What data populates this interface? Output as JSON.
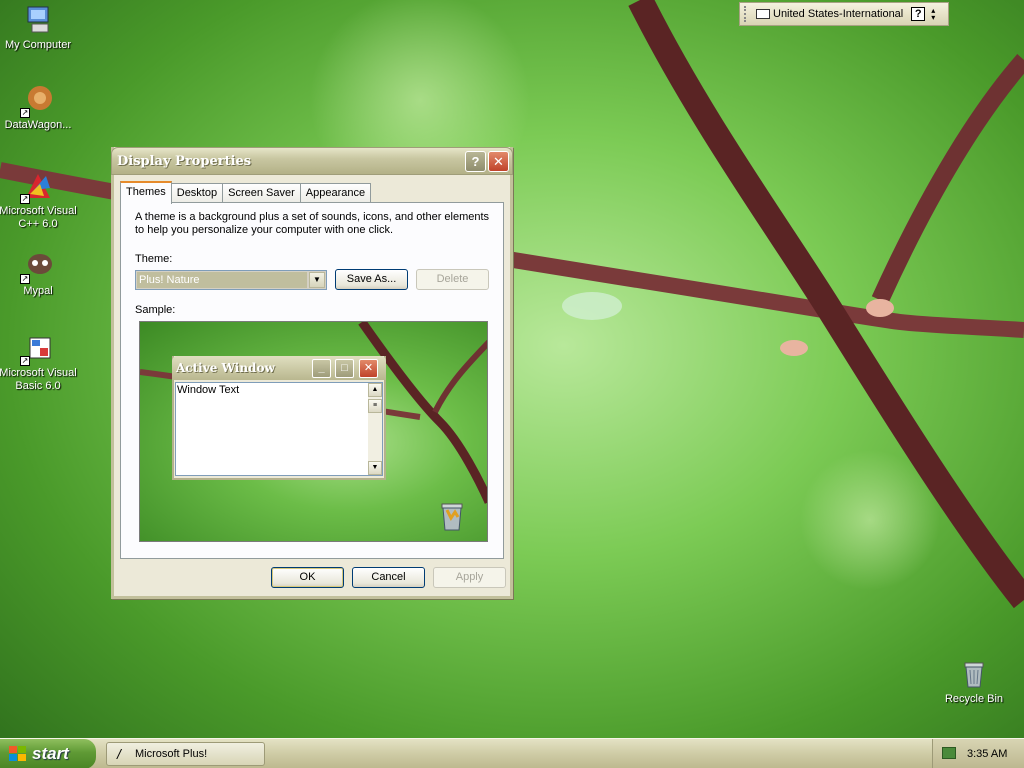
{
  "desktop": {
    "icons": [
      {
        "label": "My Computer"
      },
      {
        "label": "DataWagon..."
      },
      {
        "label": "Microsoft Visual C++ 6.0"
      },
      {
        "label": "Mypal"
      },
      {
        "label": "Microsoft Visual Basic 6.0"
      },
      {
        "label": "Recycle Bin"
      }
    ]
  },
  "langbar": {
    "language": "United States-International",
    "help_glyph": "?"
  },
  "dialog": {
    "title": "Display Properties",
    "help_glyph": "?",
    "close_glyph": "✕",
    "tabs": [
      {
        "label": "Themes"
      },
      {
        "label": "Desktop"
      },
      {
        "label": "Screen Saver"
      },
      {
        "label": "Appearance"
      }
    ],
    "active_tab": "Themes",
    "description": "A theme is a background plus a set of sounds, icons, and other elements to help you personalize your computer with one click.",
    "theme_label": "Theme:",
    "theme_value": "Plus! Nature",
    "save_as_label": "Save As...",
    "delete_label": "Delete",
    "sample_label": "Sample:",
    "sample": {
      "window_title": "Active Window",
      "window_text": "Window Text"
    },
    "ok_label": "OK",
    "cancel_label": "Cancel",
    "apply_label": "Apply"
  },
  "taskbar": {
    "start_label": "start",
    "task_item": "Microsoft Plus!",
    "clock": "3:35 AM"
  }
}
